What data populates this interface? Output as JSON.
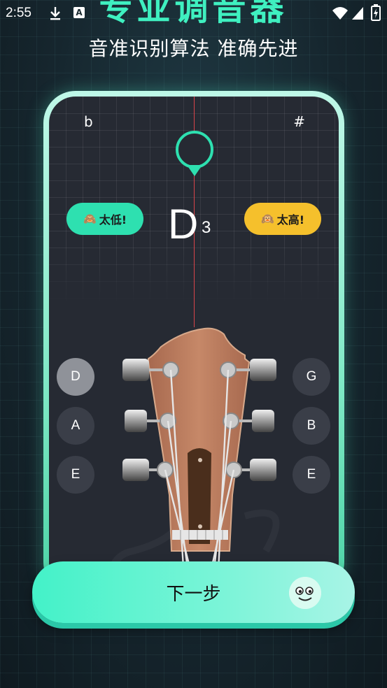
{
  "status_bar": {
    "time": "2:55",
    "download_icon": "download-icon",
    "notification_icon_label": "A"
  },
  "header": {
    "title": "专业调音器",
    "subtitle": "音准识别算法 准确先进"
  },
  "tuner": {
    "flat_symbol": "b",
    "sharp_symbol": "#",
    "note": "D",
    "octave": "3",
    "low_label": "太低!",
    "high_label": "太高!",
    "low_emoji": "🙈",
    "high_emoji": "🙉"
  },
  "strings": {
    "left": [
      "D",
      "A",
      "E"
    ],
    "right": [
      "G",
      "B",
      "E"
    ],
    "active": "D"
  },
  "next_button": {
    "label": "下一步"
  },
  "colors": {
    "accent": "#3ff0c0",
    "low": "#2ee0b0",
    "high": "#f5c02c",
    "card_bg": "#262a33"
  }
}
